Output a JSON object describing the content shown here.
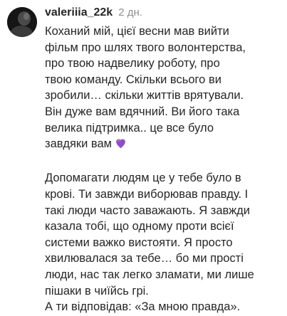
{
  "comment": {
    "username": "valeriiia_22k",
    "timestamp": "2 дн.",
    "avatar_icon": "user-avatar-icon",
    "emoji_icon": "purple-heart-icon",
    "paragraph_1_lines": [
      "Коханий мій, цієї весни мав вийти",
      "фільм про шлях твого волонтерства,",
      "про твою надвелику роботу, про",
      "твою команду. Скільки всього ви",
      "зробили… скільки життів врятували.",
      "Він дуже вам вдячний. Ви його така",
      "велика підтримка.. це все було",
      "завдяки вам"
    ],
    "paragraph_2_lines": [
      "Допомагати людям це у тебе було в",
      "крові. Ти завжди виборював правду. І",
      "такі люди часто заважають. Я завжди",
      "казала тобі, що одному проти всієї",
      "системи важко вистояти. Я просто",
      "хвилювалася за тебе… бо ми прості",
      "люди, нас так легко зламати, ми лише",
      "пішаки в чиїйсь грі."
    ],
    "paragraph_3_lines": [
      "А ти відповідав: «За мною правда»."
    ]
  }
}
